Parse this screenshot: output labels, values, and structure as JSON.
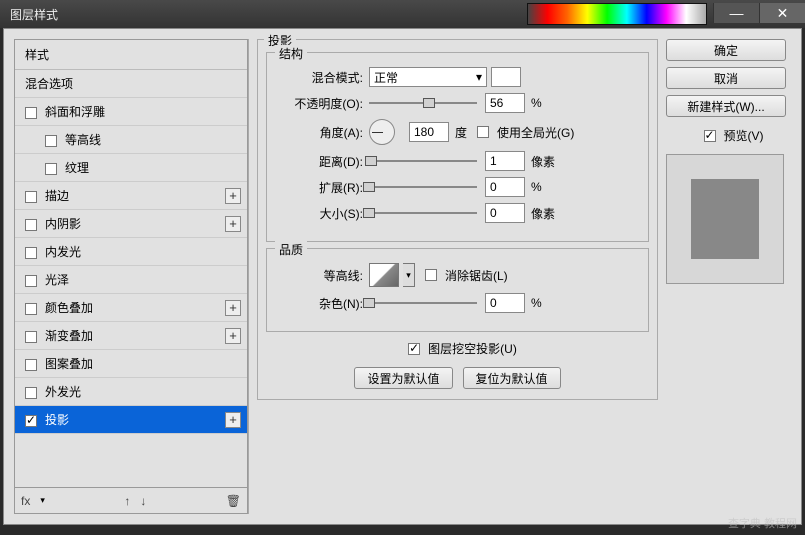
{
  "window": {
    "title": "图层样式"
  },
  "sidebar": {
    "header": "样式",
    "blending": "混合选项",
    "items": [
      {
        "label": "斜面和浮雕",
        "checked": false,
        "plus": false,
        "indent": false
      },
      {
        "label": "等高线",
        "checked": false,
        "plus": false,
        "indent": true
      },
      {
        "label": "纹理",
        "checked": false,
        "plus": false,
        "indent": true
      },
      {
        "label": "描边",
        "checked": false,
        "plus": true,
        "indent": false
      },
      {
        "label": "内阴影",
        "checked": false,
        "plus": true,
        "indent": false
      },
      {
        "label": "内发光",
        "checked": false,
        "plus": false,
        "indent": false
      },
      {
        "label": "光泽",
        "checked": false,
        "plus": false,
        "indent": false
      },
      {
        "label": "颜色叠加",
        "checked": false,
        "plus": true,
        "indent": false
      },
      {
        "label": "渐变叠加",
        "checked": false,
        "plus": true,
        "indent": false
      },
      {
        "label": "图案叠加",
        "checked": false,
        "plus": false,
        "indent": false
      },
      {
        "label": "外发光",
        "checked": false,
        "plus": false,
        "indent": false
      },
      {
        "label": "投影",
        "checked": true,
        "plus": true,
        "indent": false,
        "selected": true
      }
    ],
    "footer": {
      "fx": "fx",
      "up": "↑",
      "down": "↓",
      "trash": "🗑"
    }
  },
  "panel": {
    "title": "投影",
    "structure": {
      "legend": "结构",
      "blend_label": "混合模式:",
      "blend_value": "正常",
      "opacity_label": "不透明度(O):",
      "opacity_value": "56",
      "opacity_unit": "%",
      "angle_label": "角度(A):",
      "angle_value": "180",
      "angle_unit": "度",
      "global_label": "使用全局光(G)",
      "global_checked": false,
      "distance_label": "距离(D):",
      "distance_value": "1",
      "distance_unit": "像素",
      "spread_label": "扩展(R):",
      "spread_value": "0",
      "spread_unit": "%",
      "size_label": "大小(S):",
      "size_value": "0",
      "size_unit": "像素"
    },
    "quality": {
      "legend": "品质",
      "contour_label": "等高线:",
      "antialias_label": "消除锯齿(L)",
      "antialias_checked": false,
      "noise_label": "杂色(N):",
      "noise_value": "0",
      "noise_unit": "%"
    },
    "knockout": {
      "label": "图层挖空投影(U)",
      "checked": true
    },
    "buttons": {
      "setdefault": "设置为默认值",
      "resetdefault": "复位为默认值"
    }
  },
  "right": {
    "ok": "确定",
    "cancel": "取消",
    "newstyle": "新建样式(W)...",
    "preview_label": "预览(V)",
    "preview_checked": true
  },
  "watermark": "查字典 教程网"
}
